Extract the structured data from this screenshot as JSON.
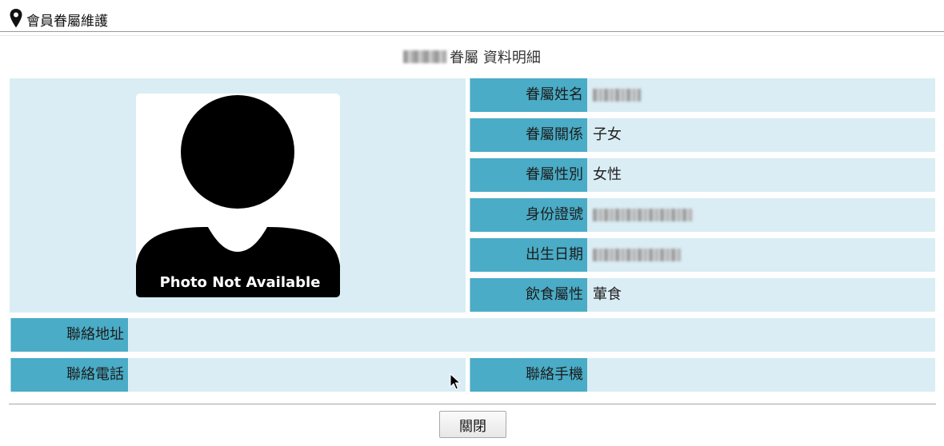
{
  "breadcrumb": {
    "icon": "map-pin-icon",
    "text": "會員眷屬維護"
  },
  "title": {
    "name_masked": "",
    "text": "眷屬 資料明細"
  },
  "photo": {
    "placeholder_text": "Photo Not Available"
  },
  "fields": {
    "name": {
      "label": "眷屬姓名",
      "value": ""
    },
    "relation": {
      "label": "眷屬關係",
      "value": "子女"
    },
    "gender": {
      "label": "眷屬性別",
      "value": "女性"
    },
    "id_number": {
      "label": "身份證號",
      "value": ""
    },
    "birth_date": {
      "label": "出生日期",
      "value": ""
    },
    "diet": {
      "label": "飲食屬性",
      "value": "葷食"
    },
    "address": {
      "label": "聯絡地址",
      "value": ""
    },
    "phone": {
      "label": "聯絡電話",
      "value": ""
    },
    "mobile": {
      "label": "聯絡手機",
      "value": ""
    }
  },
  "buttons": {
    "close_label": "關閉"
  },
  "colors": {
    "label_bg": "#4aacc6",
    "value_bg": "#daedf4"
  }
}
